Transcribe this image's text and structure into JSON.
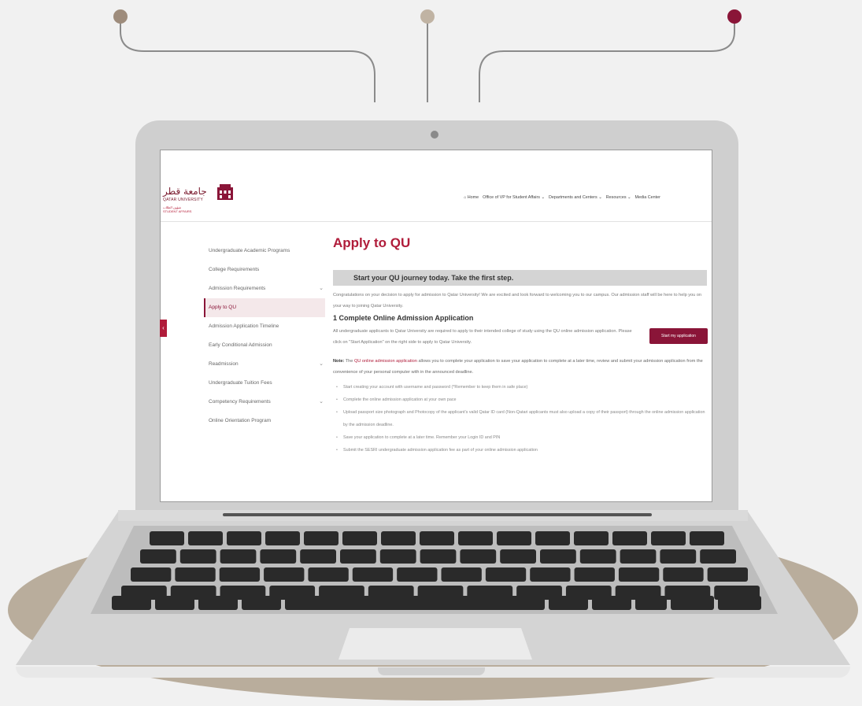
{
  "colors": {
    "brand": "#8a1538",
    "accent": "#b01c3a",
    "base": "#b9ad9c",
    "lid": "#cfcfcf"
  },
  "logo": {
    "arabic": "جامعة قطر",
    "english": "QATAR UNIVERSITY",
    "sub_ar": "شؤون الطلاب",
    "sub_en": "STUDENT AFFAIRS"
  },
  "nav": [
    {
      "label": "Home",
      "icon": "home-icon"
    },
    {
      "label": "Office of VP for Student Affairs ⌄"
    },
    {
      "label": "Departments and Centers ⌄"
    },
    {
      "label": "Resources ⌄"
    },
    {
      "label": "Media Center"
    }
  ],
  "sidebar": [
    {
      "label": "Undergraduate Academic Programs",
      "expandable": false,
      "active": false
    },
    {
      "label": "College Requirements",
      "expandable": false,
      "active": false
    },
    {
      "label": "Admission Requirements",
      "expandable": true,
      "active": false
    },
    {
      "label": "Apply to QU",
      "expandable": false,
      "active": true
    },
    {
      "label": "Admission Application Timeline",
      "expandable": false,
      "active": false
    },
    {
      "label": "Early Conditional Admission",
      "expandable": false,
      "active": false
    },
    {
      "label": "Readmission",
      "expandable": true,
      "active": false
    },
    {
      "label": "Undergraduate Tuition Fees",
      "expandable": false,
      "active": false
    },
    {
      "label": "Competency Requirements",
      "expandable": true,
      "active": false
    },
    {
      "label": "Online Orientation Program",
      "expandable": false,
      "active": false
    }
  ],
  "main": {
    "title": "Apply to QU",
    "banner": "Start your QU journey today. Take the first step.",
    "intro": "Congratulations on your decision to apply for admission to Qatar University! We are excited and look forward to welcoming you to our campus. Our admission staff will be here to help you on your way to joining Qatar University.",
    "section_title": "1 Complete Online Admission Application",
    "section_text": "All undergraduate applicants to Qatar University are required to apply to their intended college of study using the QU online admission application. Please click on \"Start Application\" on the right side to apply to Qatar University.",
    "apply_button": "Start my application",
    "note_label": "Note:",
    "note_pre": "The",
    "note_link": "QU online admission application",
    "note_post": "allows you to complete your application to save your application to complete at a later time, review and submit your admission application from the convenience of your personal computer with in the announced deadline.",
    "bullets": [
      "Start creating your account with username and password (*Remember to keep them in safe place)",
      "Complete the online admission application at your own pace",
      "Upload passport size photograph and Photocopy of the applicant's valid Qatar ID card (Non-Qatari applicants must also upload a copy of their passport) through the online admission application by the admission deadline.",
      "Save your application to complete at a later time. Remember your Login ID and PIN",
      "Submit the SESRI undergraduate admission application fee as part of your online admission application"
    ]
  }
}
